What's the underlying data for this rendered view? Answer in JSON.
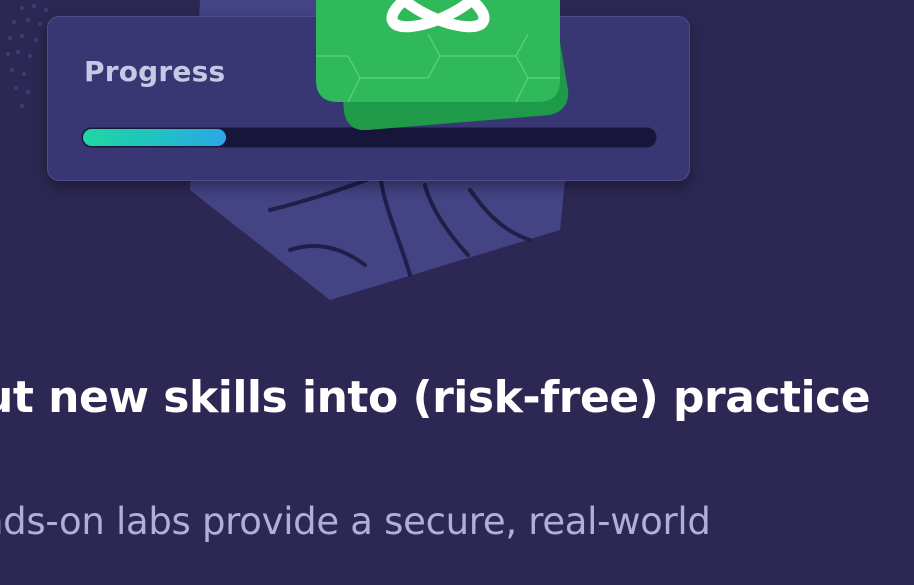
{
  "progress_card": {
    "label": "Progress",
    "value": 0.25
  },
  "badge": {
    "icon": "atom-icon"
  },
  "hero": {
    "headline": "ut new skills into (risk-free) practice",
    "subtext": "nds-on labs provide a secure, real-world"
  },
  "colors": {
    "background": "#2c2853",
    "card": "#393773",
    "badge_green": "#2fb95b",
    "progress_start": "#1fd6a3",
    "progress_end": "#2aa8e8"
  }
}
